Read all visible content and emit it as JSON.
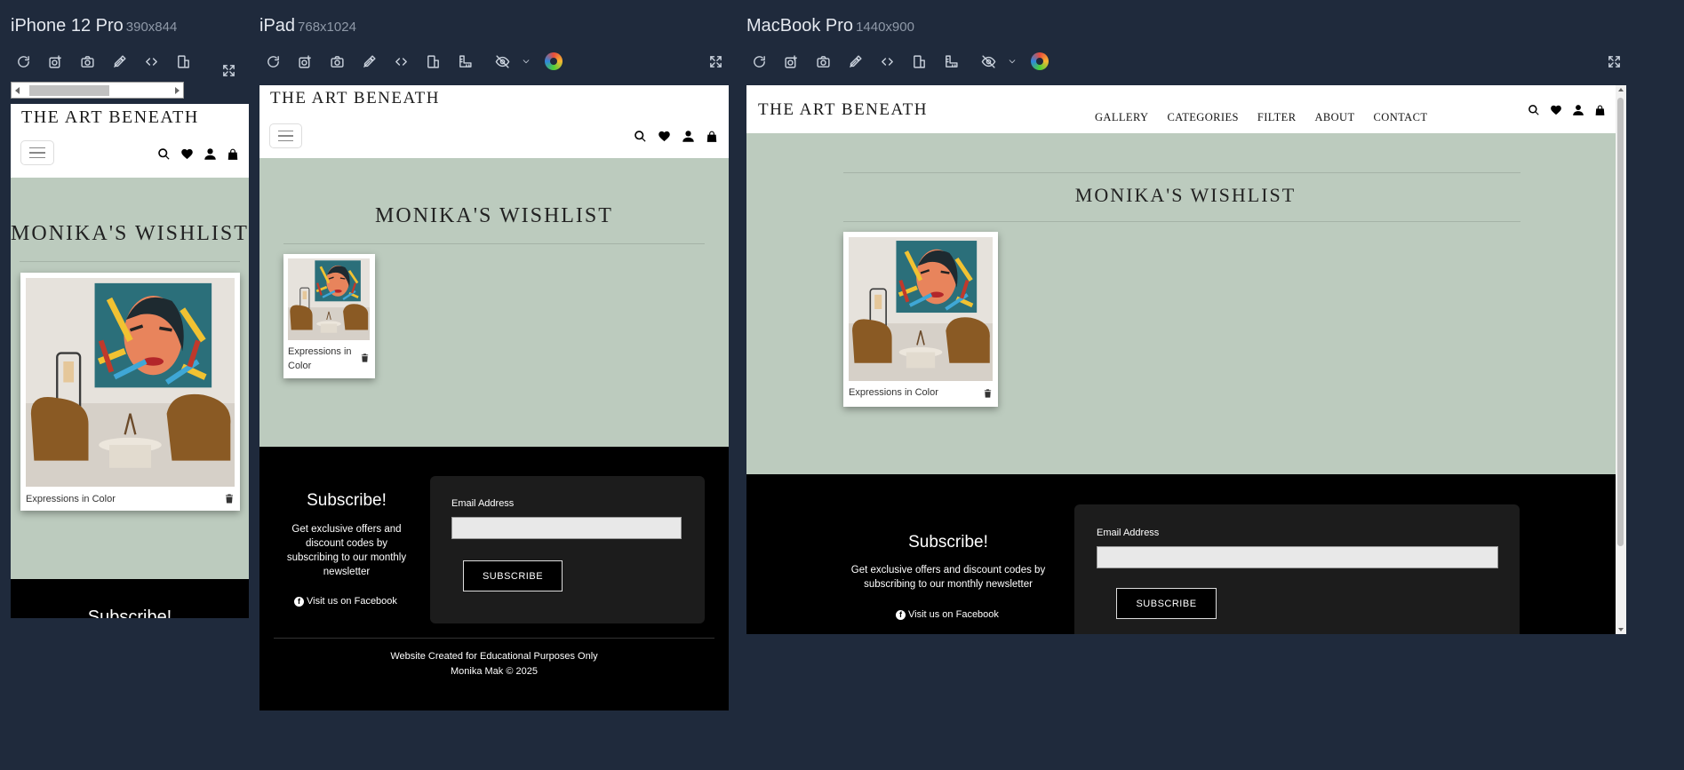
{
  "devices": [
    {
      "name": "iPhone 12 Pro",
      "dims": "390x844"
    },
    {
      "name": "iPad",
      "dims": "768x1024"
    },
    {
      "name": "MacBook Pro",
      "dims": "1440x900"
    }
  ],
  "toolbar_icons": [
    "refresh-icon",
    "screenshot-icon",
    "camera-icon",
    "eyedropper-icon",
    "code-icon",
    "rotate-icon",
    "ruler-icon",
    "eye-slash-icon",
    "chevron-down-icon",
    "color-blind-icon",
    "fullscreen-icon"
  ],
  "site": {
    "logo": "THE ART BENEATH",
    "nav": [
      "GALLERY",
      "CATEGORIES",
      "FILTER",
      "ABOUT",
      "CONTACT"
    ],
    "header_icons": [
      "search-icon",
      "heart-icon",
      "user-icon",
      "bag-icon"
    ],
    "wishlist_title": "MONIKA'S WISHLIST",
    "item": {
      "title": "Expressions in Color"
    },
    "subscribe": {
      "heading": "Subscribe!",
      "text": "Get exclusive offers and discount codes by subscribing to our monthly newsletter",
      "facebook": "Visit us on Facebook",
      "email_label": "Email Address",
      "button": "SUBSCRIBE"
    },
    "footer": {
      "line1": "Website Created for Educational Purposes Only",
      "line2": "Monika Mak © 2025"
    }
  },
  "colors": {
    "page_bg": "#1f2a3c",
    "main_bg": "#bccbbe",
    "footer_bg": "#000000",
    "form_bg": "#1c1c1c"
  }
}
